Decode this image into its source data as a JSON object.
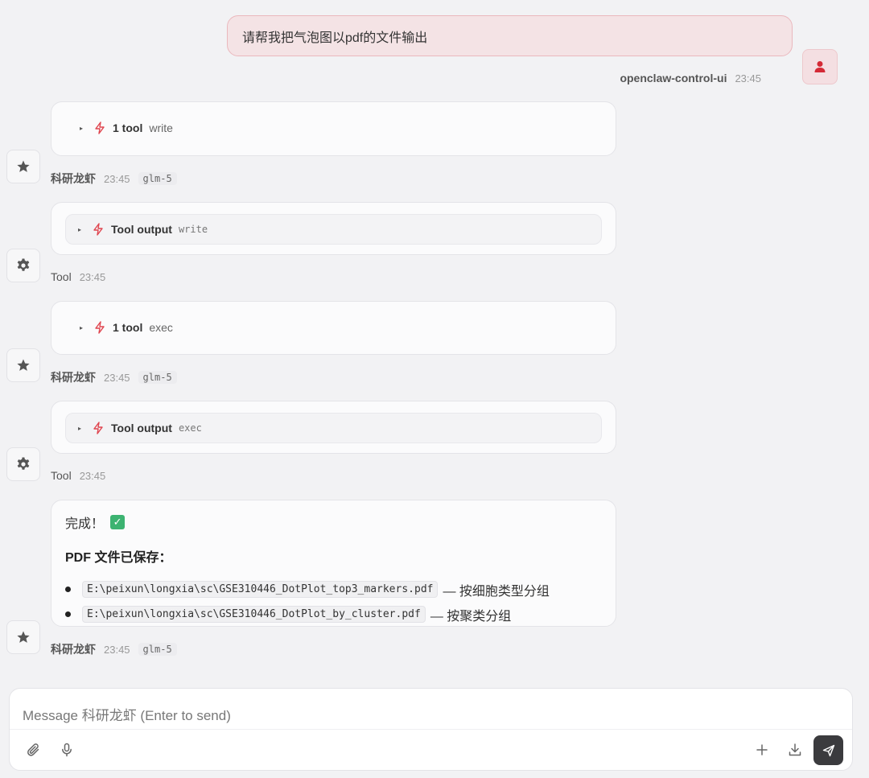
{
  "user_message": {
    "text": "请帮我把气泡图以pdf的文件输出",
    "sender": "openclaw-control-ui",
    "time": "23:45"
  },
  "messages": [
    {
      "kind": "tool_call",
      "label": "1 tool",
      "tool": "write",
      "sender": "科研龙虾",
      "time": "23:45",
      "model": "glm-5"
    },
    {
      "kind": "tool_output",
      "label": "Tool output",
      "tool": "write",
      "sender": "Tool",
      "time": "23:45"
    },
    {
      "kind": "tool_call",
      "label": "1 tool",
      "tool": "exec",
      "sender": "科研龙虾",
      "time": "23:45",
      "model": "glm-5"
    },
    {
      "kind": "tool_output",
      "label": "Tool output",
      "tool": "exec",
      "sender": "Tool",
      "time": "23:45"
    }
  ],
  "final_message": {
    "done_text": "完成！",
    "heading": "PDF 文件已保存：",
    "files": [
      {
        "path": "E:\\peixun\\longxia\\sc\\GSE310446_DotPlot_top3_markers.pdf",
        "desc": "— 按细胞类型分组"
      },
      {
        "path": "E:\\peixun\\longxia\\sc\\GSE310446_DotPlot_by_cluster.pdf",
        "desc": "— 按聚类分组"
      }
    ],
    "sender": "科研龙虾",
    "time": "23:45",
    "model": "glm-5"
  },
  "composer": {
    "placeholder": "Message 科研龙虾 (Enter to send)"
  },
  "colors": {
    "accent": "#e0454f",
    "user_bubble_bg": "#f4e3e5",
    "send_button": "#3b3b3e"
  },
  "icons": {
    "tool": "bolt-icon",
    "assistant_avatar": "star-icon",
    "tool_avatar": "gear-icon",
    "user_avatar": "user-icon"
  }
}
